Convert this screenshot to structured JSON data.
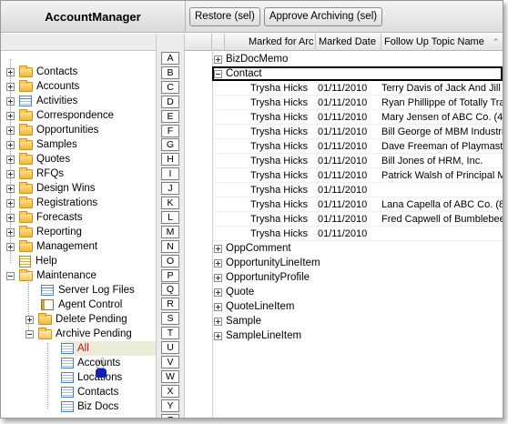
{
  "app": {
    "title": "AccountManager"
  },
  "toolbar": {
    "restore_label": "Restore (sel)",
    "approve_label": "Approve Archiving (sel)"
  },
  "columns": {
    "marked_for": "Marked for Arc",
    "marked_date": "Marked Date",
    "follow_up": "Follow Up Topic Name",
    "sort_glyph": "⌃"
  },
  "tree": {
    "items": [
      {
        "label": "Contacts",
        "icon": "folder-icon"
      },
      {
        "label": "Accounts",
        "icon": "folder-icon"
      },
      {
        "label": "Activities",
        "icon": "grid-icon"
      },
      {
        "label": "Correspondence",
        "icon": "folder-icon"
      },
      {
        "label": "Opportunities",
        "icon": "folder-icon"
      },
      {
        "label": "Samples",
        "icon": "folder-icon"
      },
      {
        "label": "Quotes",
        "icon": "folder-icon"
      },
      {
        "label": "RFQs",
        "icon": "folder-icon"
      },
      {
        "label": "Design Wins",
        "icon": "folder-icon"
      },
      {
        "label": "Registrations",
        "icon": "folder-icon"
      },
      {
        "label": "Forecasts",
        "icon": "folder-icon"
      },
      {
        "label": "Reporting",
        "icon": "folder-icon"
      },
      {
        "label": "Management",
        "icon": "folder-icon"
      },
      {
        "label": "Help",
        "icon": "help-icon"
      },
      {
        "label": "Maintenance",
        "icon": "folder-open-icon"
      }
    ],
    "maintenance_children": [
      {
        "label": "Server Log Files",
        "icon": "grid-icon"
      },
      {
        "label": "Agent Control",
        "icon": "agent-icon"
      },
      {
        "label": "Delete Pending",
        "icon": "folder-icon"
      },
      {
        "label": "Archive Pending",
        "icon": "folder-open-icon"
      }
    ],
    "archive_children": [
      {
        "label": "All"
      },
      {
        "label": "Accounts"
      },
      {
        "label": "Locations"
      },
      {
        "label": "Contacts"
      },
      {
        "label": "Biz Docs"
      }
    ]
  },
  "alphabet": [
    "A",
    "B",
    "C",
    "D",
    "E",
    "F",
    "G",
    "H",
    "I",
    "J",
    "K",
    "L",
    "M",
    "N",
    "O",
    "P",
    "Q",
    "R",
    "S",
    "T",
    "U",
    "V",
    "W",
    "X",
    "Y",
    "Z"
  ],
  "groups_top": [
    {
      "label": "BizDocMemo",
      "expanded": false
    },
    {
      "label": "Contact",
      "expanded": true
    }
  ],
  "contact_rows": [
    {
      "marked_for": "Trysha Hicks",
      "date": "01/11/2010",
      "topic": "Terry Davis of Jack And Jill"
    },
    {
      "marked_for": "Trysha Hicks",
      "date": "01/11/2010",
      "topic": "Ryan Phillippe of Totally Tra"
    },
    {
      "marked_for": "Trysha Hicks",
      "date": "01/11/2010",
      "topic": "Mary Jensen of ABC Co. (47"
    },
    {
      "marked_for": "Trysha Hicks",
      "date": "01/11/2010",
      "topic": "Bill George of MBM Industri"
    },
    {
      "marked_for": "Trysha Hicks",
      "date": "01/11/2010",
      "topic": "Dave Freeman of Playmaste"
    },
    {
      "marked_for": "Trysha Hicks",
      "date": "01/11/2010",
      "topic": "Bill Jones of HRM, Inc."
    },
    {
      "marked_for": "Trysha Hicks",
      "date": "01/11/2010",
      "topic": "Patrick Walsh of Principal M"
    },
    {
      "marked_for": "Trysha Hicks",
      "date": "01/11/2010",
      "topic": ""
    },
    {
      "marked_for": "Trysha Hicks",
      "date": "01/11/2010",
      "topic": "Lana Capella of ABC Co. (8"
    },
    {
      "marked_for": "Trysha Hicks",
      "date": "01/11/2010",
      "topic": "Fred Capwell of Bumblebee"
    },
    {
      "marked_for": "Trysha Hicks",
      "date": "01/11/2010",
      "topic": ""
    }
  ],
  "groups_bottom": [
    {
      "label": "OppComment"
    },
    {
      "label": "OpportunityLineItem"
    },
    {
      "label": "OpportunityProfile"
    },
    {
      "label": "Quote"
    },
    {
      "label": "QuoteLineItem"
    },
    {
      "label": "Sample"
    },
    {
      "label": "SampleLineItem"
    }
  ],
  "colors": {
    "selected_text": "#d01010",
    "selection_bg": "#ececd9"
  }
}
